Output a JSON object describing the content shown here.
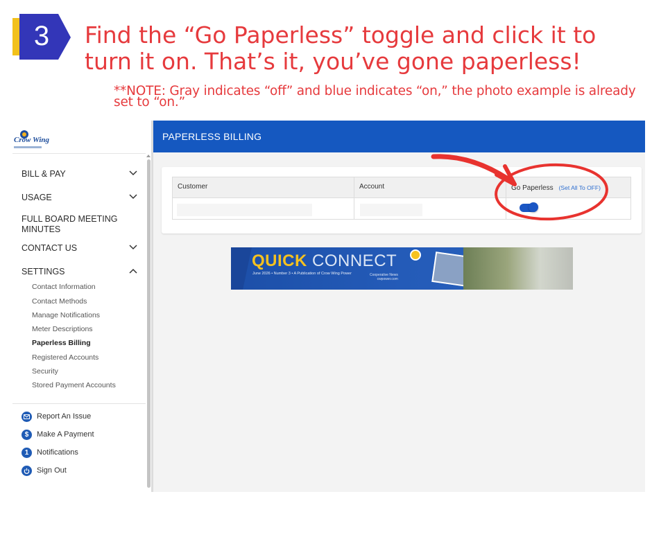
{
  "step": {
    "number": "3",
    "title": "Find the “Go Paperless” toggle and click it to turn it on. That’s it, you’ve gone paperless!",
    "note": "**NOTE: Gray indicates “off” and blue indicates “on,” the photo example is already set to “on.”"
  },
  "logo": {
    "text": "Crow Wing"
  },
  "sidebar": {
    "items": [
      {
        "label": "BILL & PAY",
        "chevron": "down"
      },
      {
        "label": "USAGE",
        "chevron": "down"
      },
      {
        "label": "FULL BOARD MEETING MINUTES",
        "chevron": ""
      },
      {
        "label": "CONTACT US",
        "chevron": "down"
      },
      {
        "label": "SETTINGS",
        "chevron": "up"
      }
    ],
    "settings_sub": [
      "Contact Information",
      "Contact Methods",
      "Manage Notifications",
      "Meter Descriptions",
      "Paperless Billing",
      "Registered Accounts",
      "Security",
      "Stored Payment Accounts"
    ],
    "active_sub": "Paperless Billing",
    "actions": [
      {
        "label": "Report An Issue",
        "icon": "mail-icon"
      },
      {
        "label": "Make A Payment",
        "icon": "dollar-icon"
      },
      {
        "label": "Notifications",
        "icon": "notification-count-icon",
        "count": "1"
      },
      {
        "label": "Sign Out",
        "icon": "power-icon"
      }
    ]
  },
  "page": {
    "title": "PAPERLESS BILLING"
  },
  "table": {
    "columns": [
      "Customer",
      "Account",
      "Go Paperless"
    ],
    "set_all": "(Set All To OFF)",
    "row": {
      "paperless_on": true
    }
  },
  "banner": {
    "title_1": "QUICK",
    "title_2": "CONNECT",
    "subtitle": "June 2026 • Number 3 • A Publication of Crow Wing Power",
    "coop_1": "Cooperative News",
    "coop_2": "cwpower.com"
  },
  "colors": {
    "accent_red": "#e63a3d",
    "brand_blue": "#1558c0",
    "toggle_on": "#1a56c4",
    "badge_blue": "#3a3fc0"
  }
}
